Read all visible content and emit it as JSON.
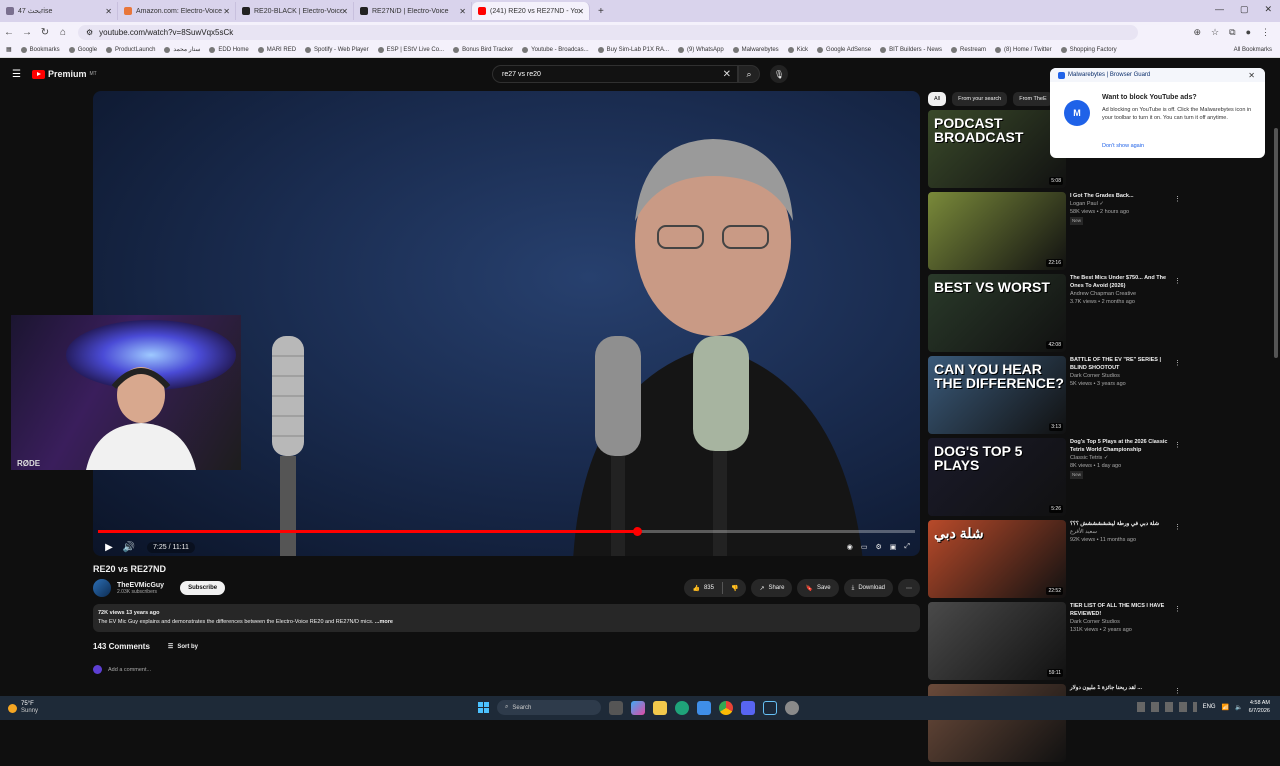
{
  "browser": {
    "tabs": [
      {
        "label": "بحث 47rise",
        "color": "#7a6f8f",
        "active": false
      },
      {
        "label": "Amazon.com: Electro-Voice RE20",
        "color": "#e8763a",
        "active": false
      },
      {
        "label": "RE20-BLACK | Electro-Voice",
        "color": "#222222",
        "active": false
      },
      {
        "label": "RE27N/D | Electro-Voice",
        "color": "#222222",
        "active": false
      },
      {
        "label": "(241) RE20 vs RE27ND - YouTube",
        "color": "#ff0000",
        "active": true
      }
    ],
    "new_tab": "+",
    "url": "youtube.com/watch?v=8SuwVqx5sCk",
    "bookmarks": [
      "Bookmarks",
      "Google",
      "ProductLaunch",
      "ستار محمد",
      "EDD Home",
      "MARI RED",
      "Spotify - Web Player",
      "ESP | EStV Live Co...",
      "Bonus Bird Tracker",
      "Youtube - Broadcas...",
      "Buy Sim-Lab P1X RA...",
      "(9) WhatsApp",
      "Malwarebytes",
      "Kick",
      "Google AdSense",
      "BIT Builders - News",
      "Restream",
      "(8) Home / Twitter",
      "Shopping Factory"
    ],
    "all_bookmarks": "All Bookmarks"
  },
  "youtube": {
    "logo": "Premium",
    "logo_sup": "MT",
    "search_query": "re27 vs re20",
    "video": {
      "title": "RE20 vs RE27ND",
      "time": "7:25 / 11:11",
      "progress": 0.66,
      "buffered": 0.75,
      "webcam_brand": "RØDE"
    },
    "channel": {
      "name": "TheEVMicGuy",
      "subscribers": "2.03K subscribers",
      "subscribe": "Subscribe"
    },
    "actions": {
      "likes": "835",
      "share": "Share",
      "save": "Save",
      "download": "Download"
    },
    "description": {
      "meta": "72K views  13 years ago",
      "text": "The EV Mic Guy explains and demonstrates the differences between the Electro-Voice RE20 and RE27N/D mics.",
      "more": "...more"
    },
    "comments": {
      "count": "143 Comments",
      "sort": "Sort by",
      "add": "Add a comment..."
    },
    "chips": [
      "All",
      "From your search",
      "From TheE"
    ],
    "related": [
      {
        "title": "",
        "channel": "",
        "meta": "",
        "badge": "",
        "duration": "5:08",
        "thumb_text": "PODCAST BROADCAST",
        "bg": "#3a4a2a"
      },
      {
        "title": "I Got The Grades Back...",
        "channel": "Logan Paul ✓",
        "meta": "58K views • 2 hours ago",
        "badge": "New",
        "duration": "22:16",
        "thumb_text": "",
        "bg": "#7a8a3a"
      },
      {
        "title": "The Best Mics Under $750... And The Ones To Avoid (2026)",
        "channel": "Andrew Chapman Creative",
        "meta": "3.7K views • 2 months ago",
        "badge": "",
        "duration": "42:08",
        "thumb_text": "BEST VS WORST",
        "bg": "#2a3a2a"
      },
      {
        "title": "BATTLE OF THE EV \"RE\" SERIES | BLIND SHOOTOUT",
        "channel": "Dark Corner Studios",
        "meta": "5K views • 3 years ago",
        "badge": "",
        "duration": "3:13",
        "thumb_text": "CAN YOU HEAR THE DIFFERENCE?",
        "bg": "#3a5a7a"
      },
      {
        "title": "Dog's Top 5 Plays at the 2026 Classic Tetris World Championship",
        "channel": "Classic Tetris ✓",
        "meta": "8K views • 1 day ago",
        "badge": "New",
        "duration": "5:26",
        "thumb_text": "DOG'S TOP 5 PLAYS",
        "bg": "#1a1a2a"
      },
      {
        "title": "شلة دبي في ورطة ليشششششش ؟؟؟",
        "channel": "سعيد الأقرع",
        "meta": "92K views • 11 months ago",
        "badge": "",
        "duration": "22:52",
        "thumb_text": "شلة دبي",
        "bg": "#b84a2a"
      },
      {
        "title": "TIER LIST OF ALL THE MICS I HAVE REVIEWED!",
        "channel": "Dark Corner Studios",
        "meta": "131K views • 2 years ago",
        "badge": "",
        "duration": "59:11",
        "thumb_text": "",
        "bg": "#4a4a4a"
      },
      {
        "title": "لقد ربحنا جائزة 1 مليون دولار ...",
        "channel": "",
        "meta": "",
        "badge": "",
        "duration": "",
        "thumb_text": "",
        "bg": "#6a4a3a"
      }
    ]
  },
  "malwarebytes": {
    "header": "Malwarebytes | Browser Guard",
    "title": "Want to block YouTube ads?",
    "body": "Ad blocking on YouTube is off. Click the Malwarebytes icon in your toolbar to turn it on. You can turn it off anytime.",
    "link": "Don't show again"
  },
  "taskbar": {
    "temp": "75°F",
    "weather": "Sunny",
    "search": "Search",
    "lang": "ENG",
    "time": "4:58 AM",
    "date": "6/7/2026"
  }
}
